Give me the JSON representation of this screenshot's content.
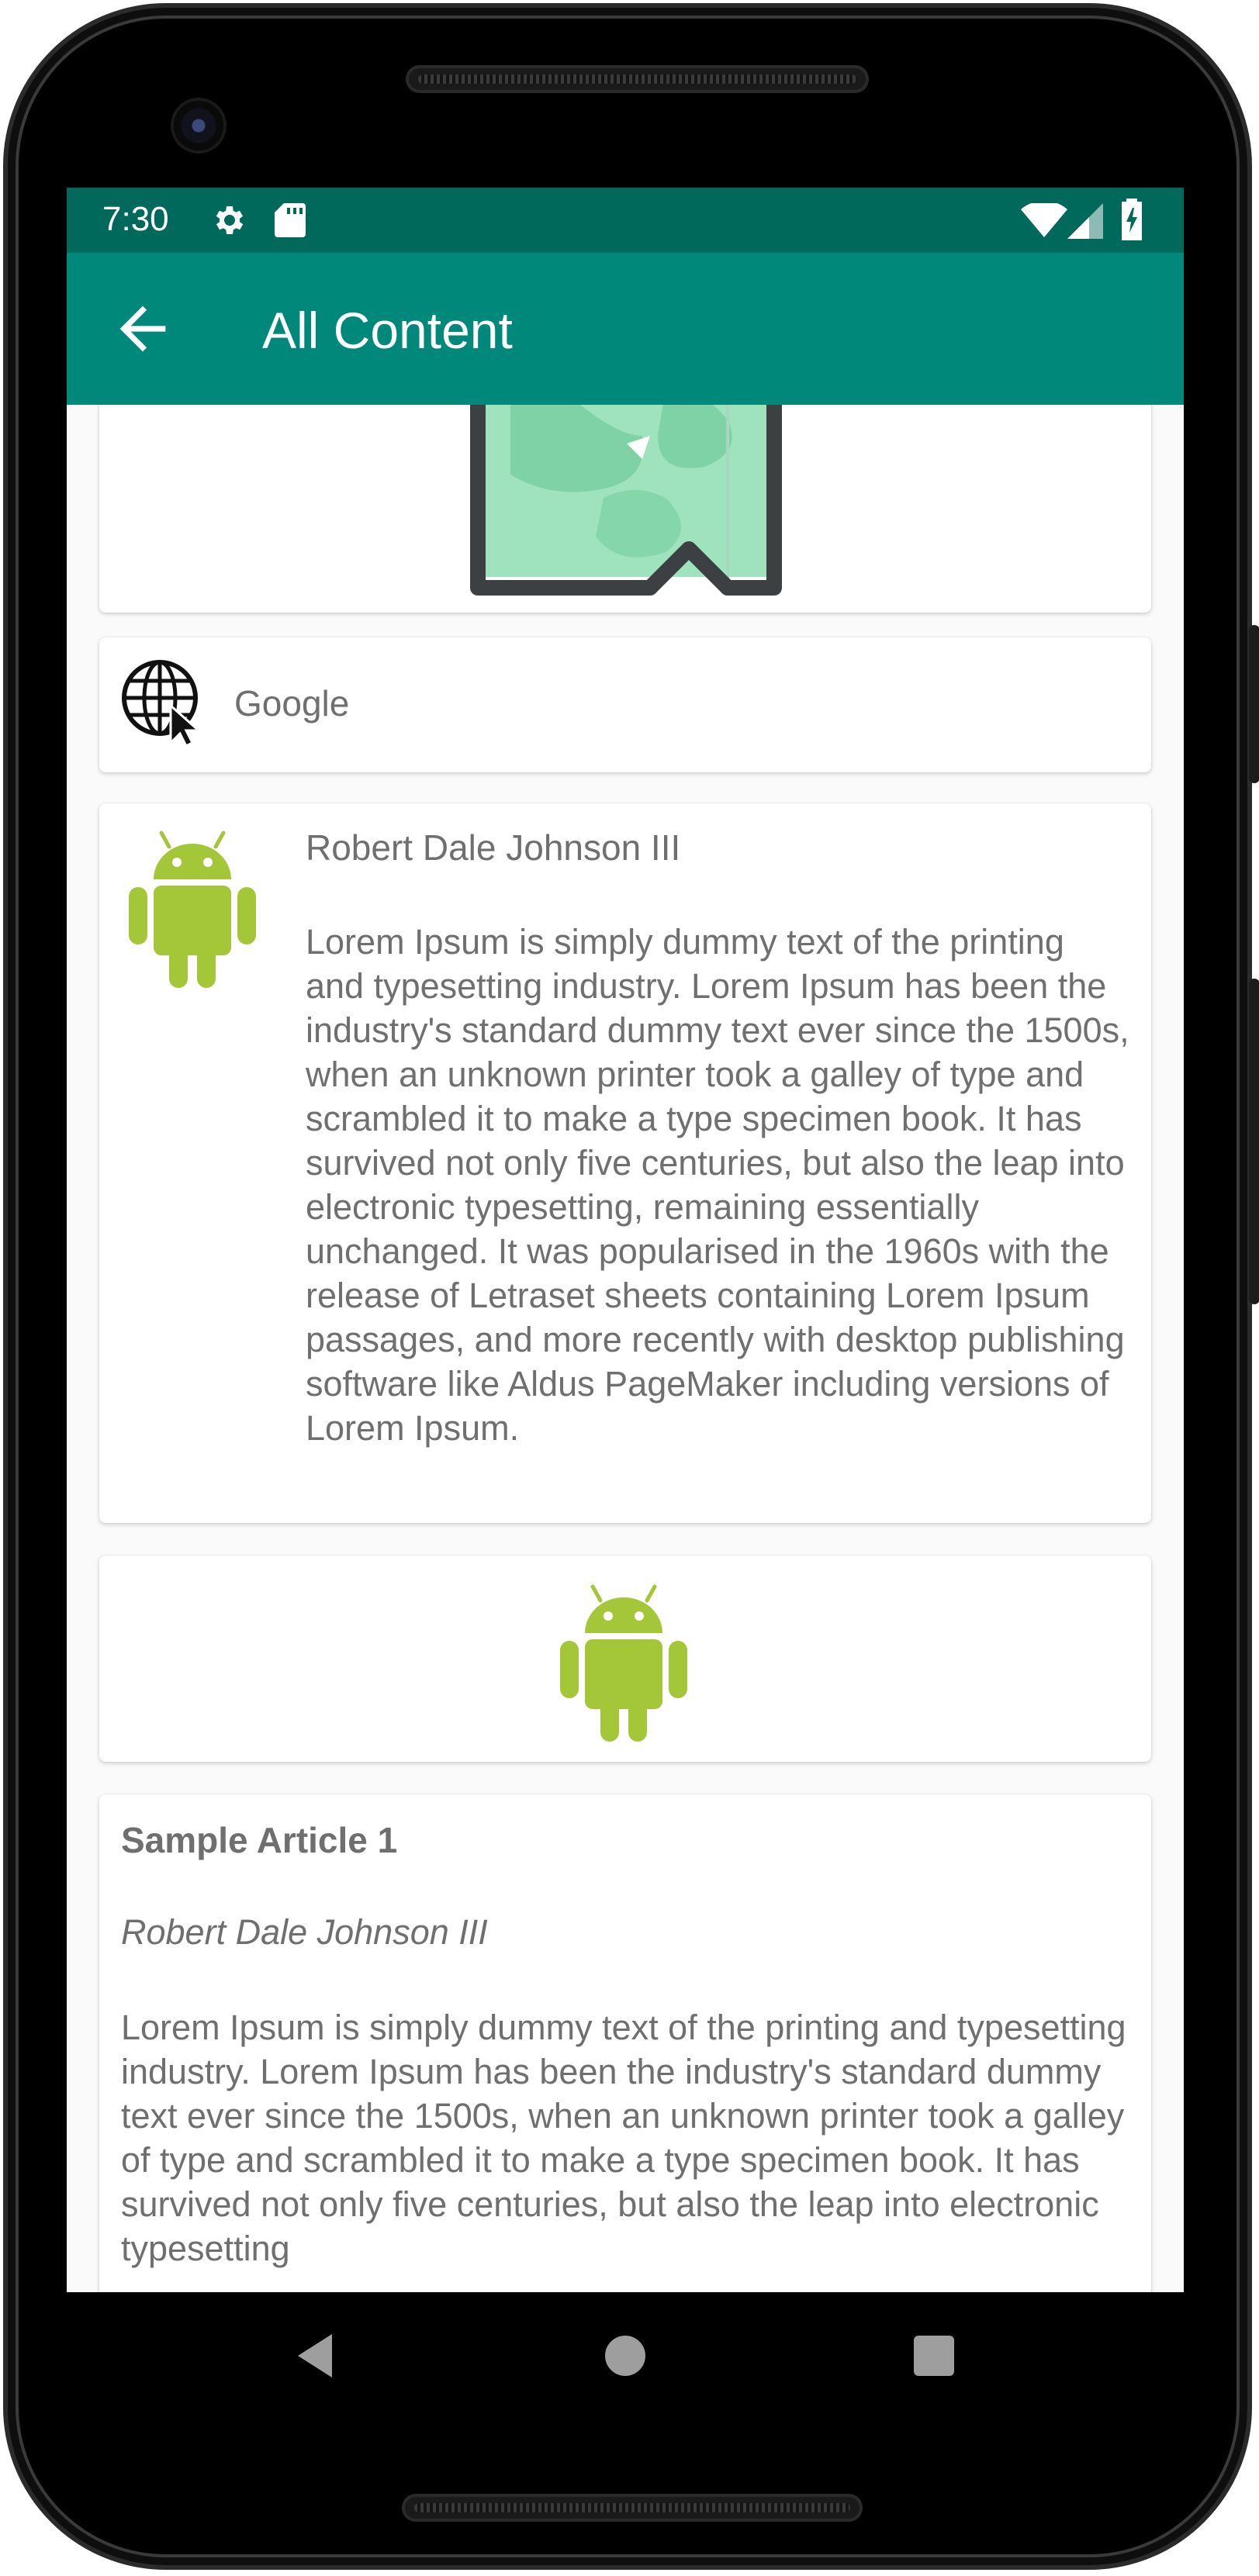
{
  "status_bar": {
    "time": "7:30",
    "icons": [
      "gear-icon",
      "sd-card-icon",
      "wifi-icon",
      "signal-icon",
      "battery-icon"
    ],
    "color": "#00695c"
  },
  "app_bar": {
    "title": "All Content",
    "back_icon": "arrow-back-icon",
    "color": "#00897b"
  },
  "cards": {
    "image_card": {
      "icon": "map-bookmark-image"
    },
    "link_card": {
      "icon": "globe-cursor-icon",
      "label": "Google"
    },
    "author_card": {
      "icon": "android-icon",
      "author": "Robert Dale Johnson III",
      "body": "Lorem Ipsum is simply dummy text of the printing and typesetting industry. Lorem Ipsum has been the industry's standard dummy text ever since the 1500s, when an unknown printer took a galley of type and scrambled it to make a type specimen book. It has survived not only five centuries, but also the leap into electronic typesetting, remaining essentially unchanged. It was popularised in the 1960s with the release of Letraset sheets containing Lorem Ipsum passages, and more recently with desktop publishing software like Aldus PageMaker including versions of Lorem Ipsum."
    },
    "icon_card": {
      "icon": "android-icon"
    },
    "article_card": {
      "title": "Sample Article 1",
      "author": "Robert Dale Johnson III",
      "body": "Lorem Ipsum is simply dummy text of the printing and typesetting industry. Lorem Ipsum has been the industry's standard dummy text ever since the 1500s, when an unknown printer took a galley of type and scrambled it to make a type specimen book. It has survived not only five centuries, but also the leap into electronic typesetting"
    }
  },
  "nav_bar": {
    "icons": [
      "nav-back-icon",
      "nav-home-icon",
      "nav-recents-icon"
    ]
  },
  "colors": {
    "android_green": "#a4c639",
    "text_gray": "#6f6f6f"
  }
}
